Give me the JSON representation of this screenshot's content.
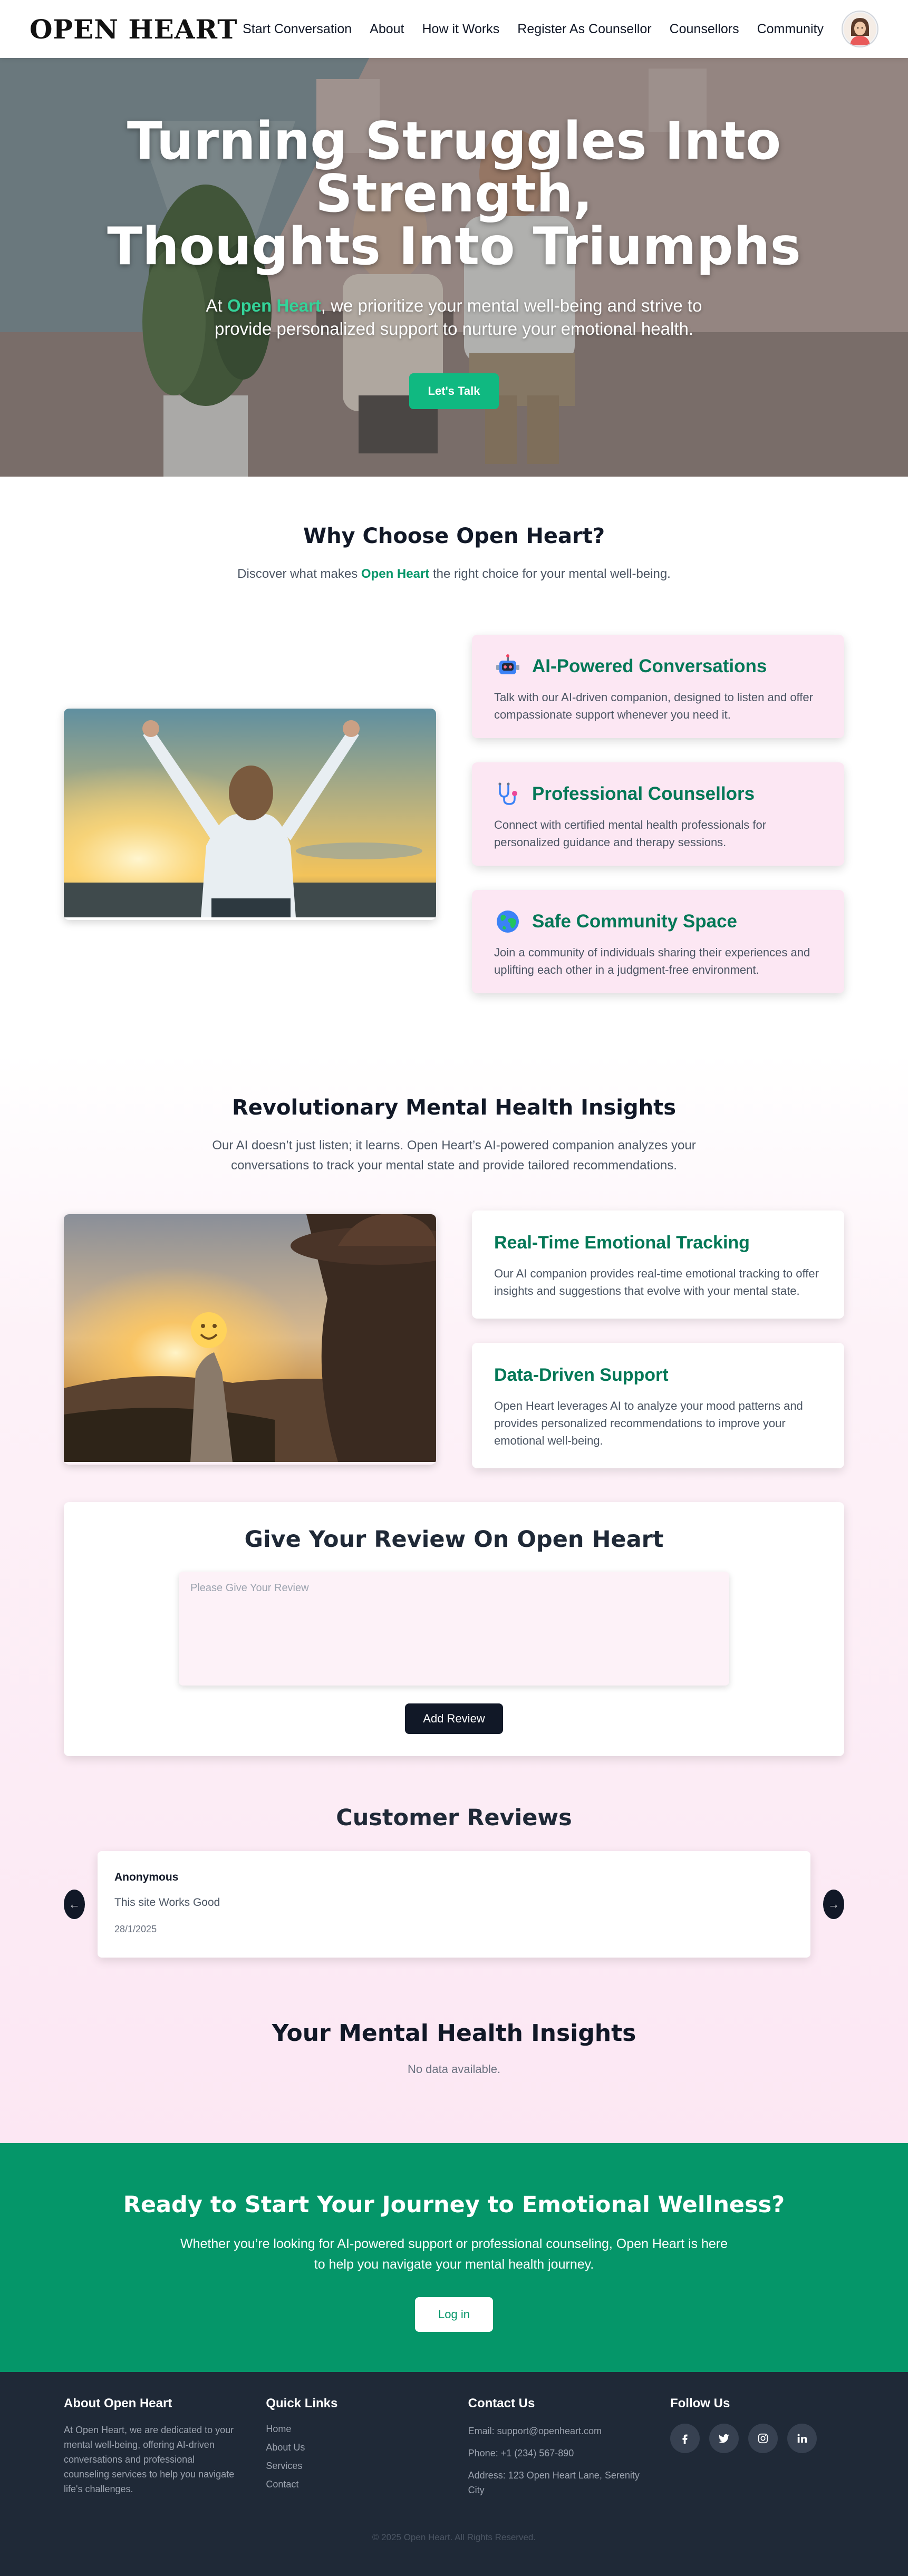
{
  "brand": {
    "logo": "OPEN HEART"
  },
  "nav": {
    "links": [
      "Start Conversation",
      "About",
      "How it Works",
      "Register As Counsellor",
      "Counsellors",
      "Community"
    ],
    "avatar_icon": "user-avatar-icon"
  },
  "hero": {
    "title_line1": "Turning Struggles Into",
    "title_line2": "Strength,",
    "title_line3": "Thoughts Into Triumphs",
    "sub_pre": "At ",
    "sub_brand": "Open Heart",
    "sub_post": ", we prioritize your mental well-being and strive to provide personalized support to nurture your emotional health.",
    "cta": "Let's Talk"
  },
  "why": {
    "title": "Why Choose Open Heart?",
    "sub_pre": "Discover what makes ",
    "sub_brand": "Open Heart",
    "sub_post": " the right choice for your mental well-being.",
    "features": [
      {
        "icon": "robot-icon",
        "title": "AI-Powered Conversations",
        "text": "Talk with our AI-driven companion, designed to listen and offer compassionate support whenever you need it."
      },
      {
        "icon": "stethoscope-icon",
        "title": "Professional Counsellors",
        "text": "Connect with certified mental health professionals for personalized guidance and therapy sessions."
      },
      {
        "icon": "globe-icon",
        "title": "Safe Community Space",
        "text": "Join a community of individuals sharing their experiences and uplifting each other in a judgment-free environment."
      }
    ]
  },
  "insights": {
    "title": "Revolutionary Mental Health Insights",
    "sub": "Our AI doesn’t just listen; it learns. Open Heart’s AI-powered companion analyzes your conversations to track your mental state and provide tailored recommendations.",
    "cards": [
      {
        "title": "Real-Time Emotional Tracking",
        "text": "Our AI companion provides real-time emotional tracking to offer insights and suggestions that evolve with your mental state."
      },
      {
        "title": "Data-Driven Support",
        "text": "Open Heart leverages AI to analyze your mood patterns and provides personalized recommendations to improve your emotional well-being."
      }
    ]
  },
  "review_form": {
    "title": "Give Your Review On Open Heart",
    "placeholder": "Please Give Your Review",
    "button": "Add Review"
  },
  "reviews": {
    "title": "Customer Reviews",
    "prev": "←",
    "next": "→",
    "items": [
      {
        "author": "Anonymous",
        "text": "This site Works Good",
        "date": "28/1/2025"
      }
    ]
  },
  "mental_health": {
    "title": "Your Mental Health Insights",
    "empty": "No data available."
  },
  "cta": {
    "title": "Ready to Start Your Journey to Emotional Wellness?",
    "sub": "Whether you’re looking for AI-powered support or professional counseling, Open Heart is here to help you navigate your mental health journey.",
    "button": "Log in"
  },
  "footer": {
    "about_title": "About Open Heart",
    "about_text": "At Open Heart, we are dedicated to your mental well-being, offering AI-driven conversations and professional counseling services to help you navigate life's challenges.",
    "links_title": "Quick Links",
    "links": [
      "Home",
      "About Us",
      "Services",
      "Contact"
    ],
    "contact_title": "Contact Us",
    "contact": [
      "Email: support@openheart.com",
      "Phone: +1 (234) 567-890",
      "Address: 123 Open Heart Lane, Serenity City"
    ],
    "follow_title": "Follow Us",
    "socials": [
      "facebook-icon",
      "twitter-icon",
      "instagram-icon",
      "linkedin-icon"
    ],
    "copyright": "© 2025 Open Heart. All Rights Reserved."
  },
  "colors": {
    "accent_green": "#10b981",
    "dark_green": "#059669",
    "card_pink": "#fce7f3",
    "footer_bg": "#1f2937"
  }
}
